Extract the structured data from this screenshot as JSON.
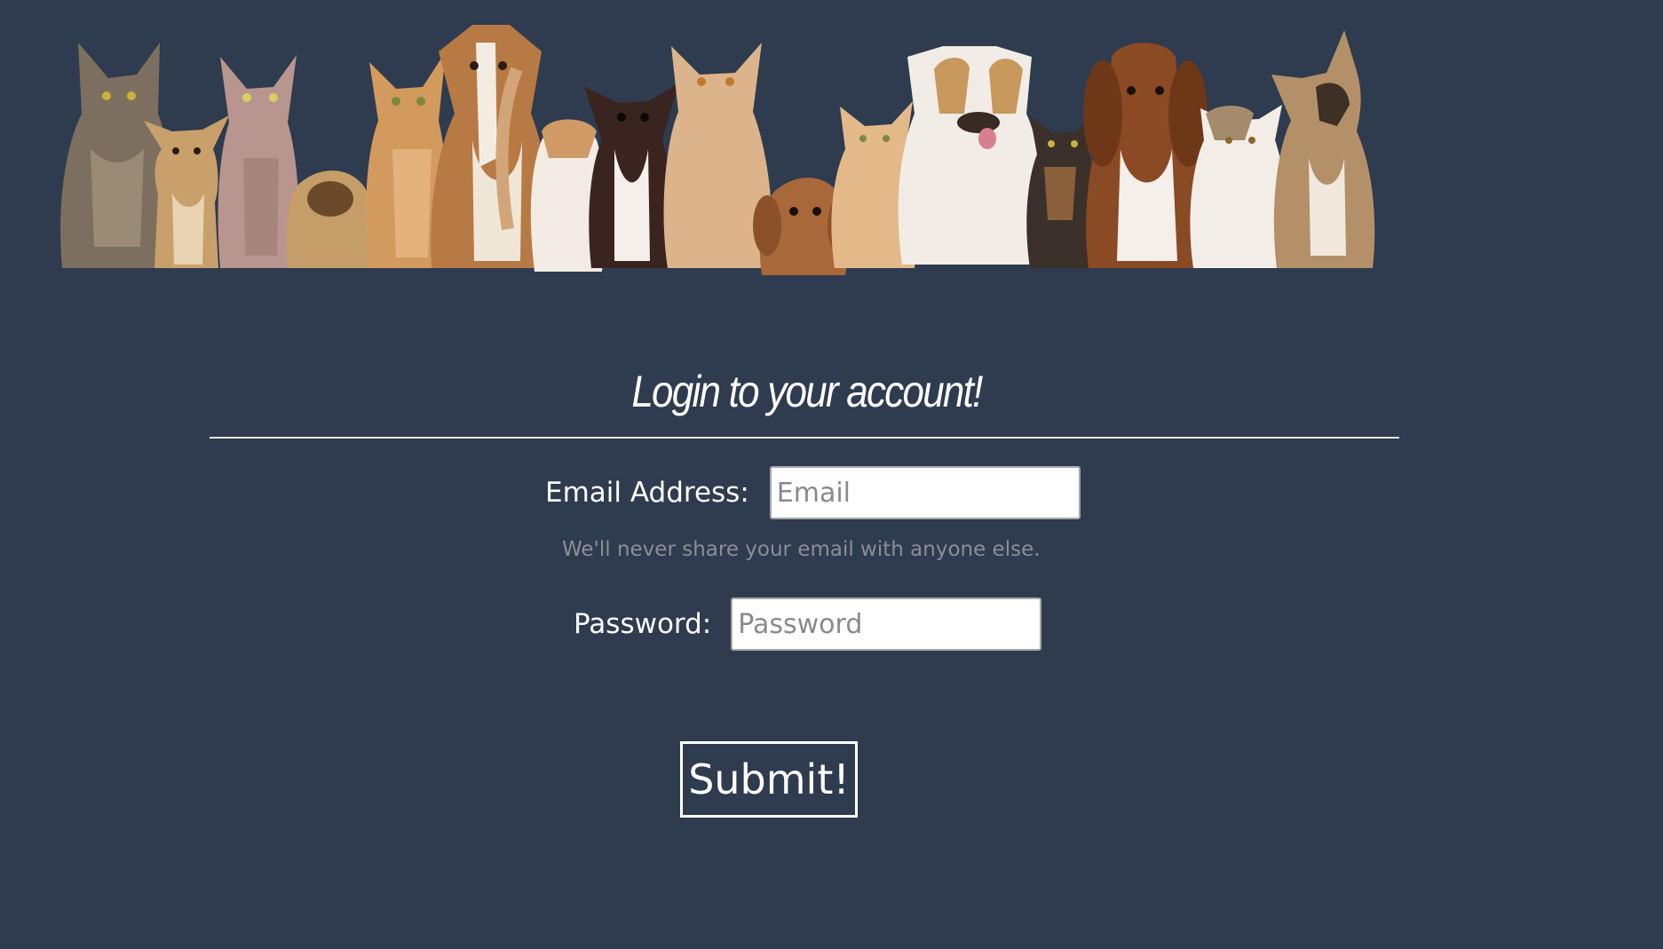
{
  "banner": {
    "animals": [
      "maine-coon-cat-icon",
      "chihuahua-puppy-icon",
      "sphynx-cat-icon",
      "pug-puppy-icon",
      "ginger-tabby-cat-icon",
      "beagle-mix-dog-icon",
      "exotic-shorthair-cat-icon",
      "chihuahua-dog-icon",
      "british-shorthair-cat-icon",
      "cavalier-puppy-icon",
      "cream-kitten-icon",
      "english-bulldog-icon",
      "tortoiseshell-kitten-icon",
      "basset-hound-icon",
      "persian-kitten-icon",
      "french-bulldog-icon"
    ]
  },
  "login": {
    "title": "Login to your account!",
    "email_label": "Email Address:",
    "email_placeholder": "Email",
    "email_help": "We'll never share your email with anyone else.",
    "password_label": "Password:",
    "password_placeholder": "Password",
    "submit_label": "Submit!"
  },
  "colors": {
    "background": "#2f3b4e",
    "text": "#ffffff",
    "help_text": "#8b8f96",
    "divider": "#e6e8ec"
  }
}
